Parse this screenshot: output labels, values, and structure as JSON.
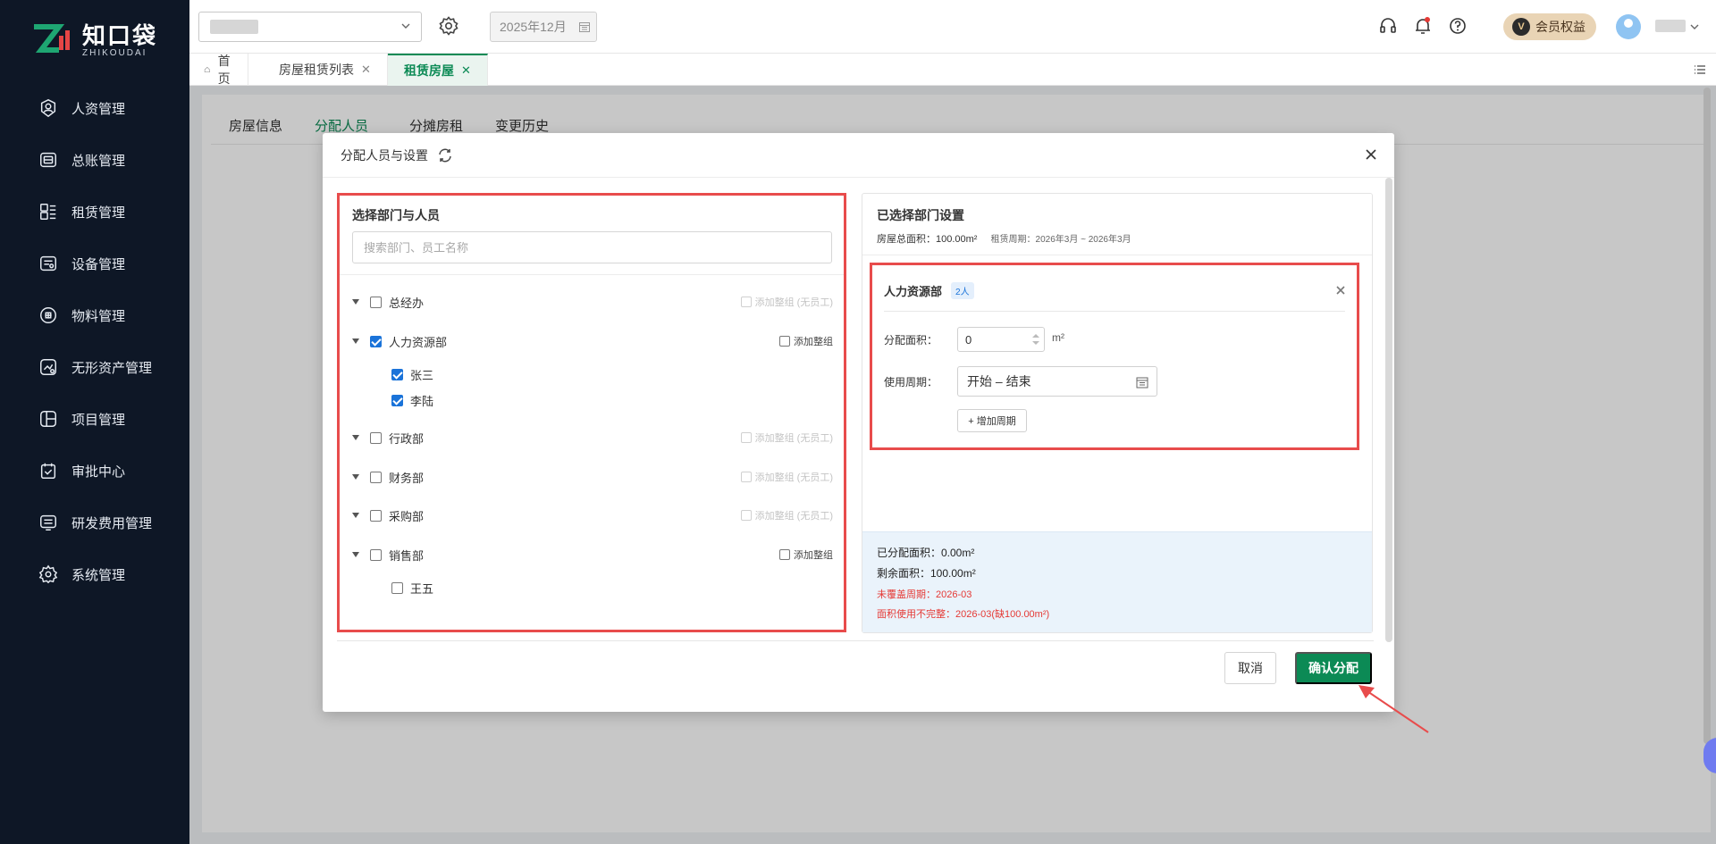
{
  "brand": {
    "name_cn": "知口袋",
    "name_en": "ZHIKOUDAI"
  },
  "sidebar": {
    "items": [
      {
        "label": "人资管理",
        "icon": "user-circle-icon"
      },
      {
        "label": "总账管理",
        "icon": "ledger-icon"
      },
      {
        "label": "租赁管理",
        "icon": "lease-icon"
      },
      {
        "label": "设备管理",
        "icon": "device-icon"
      },
      {
        "label": "物料管理",
        "icon": "material-icon"
      },
      {
        "label": "无形资产管理",
        "icon": "intangible-asset-icon"
      },
      {
        "label": "项目管理",
        "icon": "project-icon"
      },
      {
        "label": "审批中心",
        "icon": "approval-icon"
      },
      {
        "label": "研发费用管理",
        "icon": "rnd-expense-icon"
      },
      {
        "label": "系统管理",
        "icon": "gear-icon"
      }
    ]
  },
  "header": {
    "date_value": "2025年12月",
    "vip_label": "会员权益",
    "vip_badge": "V"
  },
  "tabs": [
    {
      "label": "首页",
      "closable": false
    },
    {
      "label": "房屋租赁列表",
      "closable": true
    },
    {
      "label": "租赁房屋",
      "closable": true,
      "active": true
    }
  ],
  "page_tabs": [
    "房屋信息",
    "分配人员",
    "分摊房租",
    "变更历史"
  ],
  "dialog": {
    "title": "分配人员与设置",
    "left": {
      "title": "选择部门与人员",
      "search_placeholder": "搜索部门、员工名称",
      "departments": [
        {
          "name": "总经办",
          "checked": false,
          "group_label": "添加整组 (无员工)",
          "group_enabled": false,
          "members": []
        },
        {
          "name": "人力资源部",
          "checked": true,
          "group_label": "添加整组",
          "group_enabled": true,
          "members": [
            {
              "name": "张三",
              "checked": true
            },
            {
              "name": "李陆",
              "checked": true
            }
          ]
        },
        {
          "name": "行政部",
          "checked": false,
          "group_label": "添加整组 (无员工)",
          "group_enabled": false,
          "members": []
        },
        {
          "name": "财务部",
          "checked": false,
          "group_label": "添加整组 (无员工)",
          "group_enabled": false,
          "members": []
        },
        {
          "name": "采购部",
          "checked": false,
          "group_label": "添加整组 (无员工)",
          "group_enabled": false,
          "members": []
        },
        {
          "name": "销售部",
          "checked": false,
          "group_label": "添加整组",
          "group_enabled": true,
          "members": [
            {
              "name": "王五",
              "checked": false
            }
          ]
        }
      ]
    },
    "right": {
      "title": "已选择部门设置",
      "total_area": "房屋总面积：100.00m²",
      "lease_period": "租赁周期：2026年3月 ~ 2026年3月",
      "dept_card": {
        "name": "人力资源部",
        "badge": "2人",
        "area_label": "分配面积：",
        "area_value": "0",
        "area_unit": "m²",
        "period_label": "使用周期：",
        "period_value": "开始 – 结束",
        "add_period": "+ 增加周期"
      },
      "summary": {
        "allocated": "已分配面积：0.00m²",
        "remaining": "剩余面积：100.00m²",
        "uncovered": "未覆盖周期：2026-03",
        "incomplete": "面积使用不完整：2026-03(缺100.00m²)"
      }
    },
    "cancel_label": "取消",
    "confirm_label": "确认分配"
  },
  "colors": {
    "accent": "#0c8a55",
    "highlight_border": "#e84c4c",
    "sidebar_bg": "#0e1726",
    "checkbox": "#1a73d9"
  }
}
